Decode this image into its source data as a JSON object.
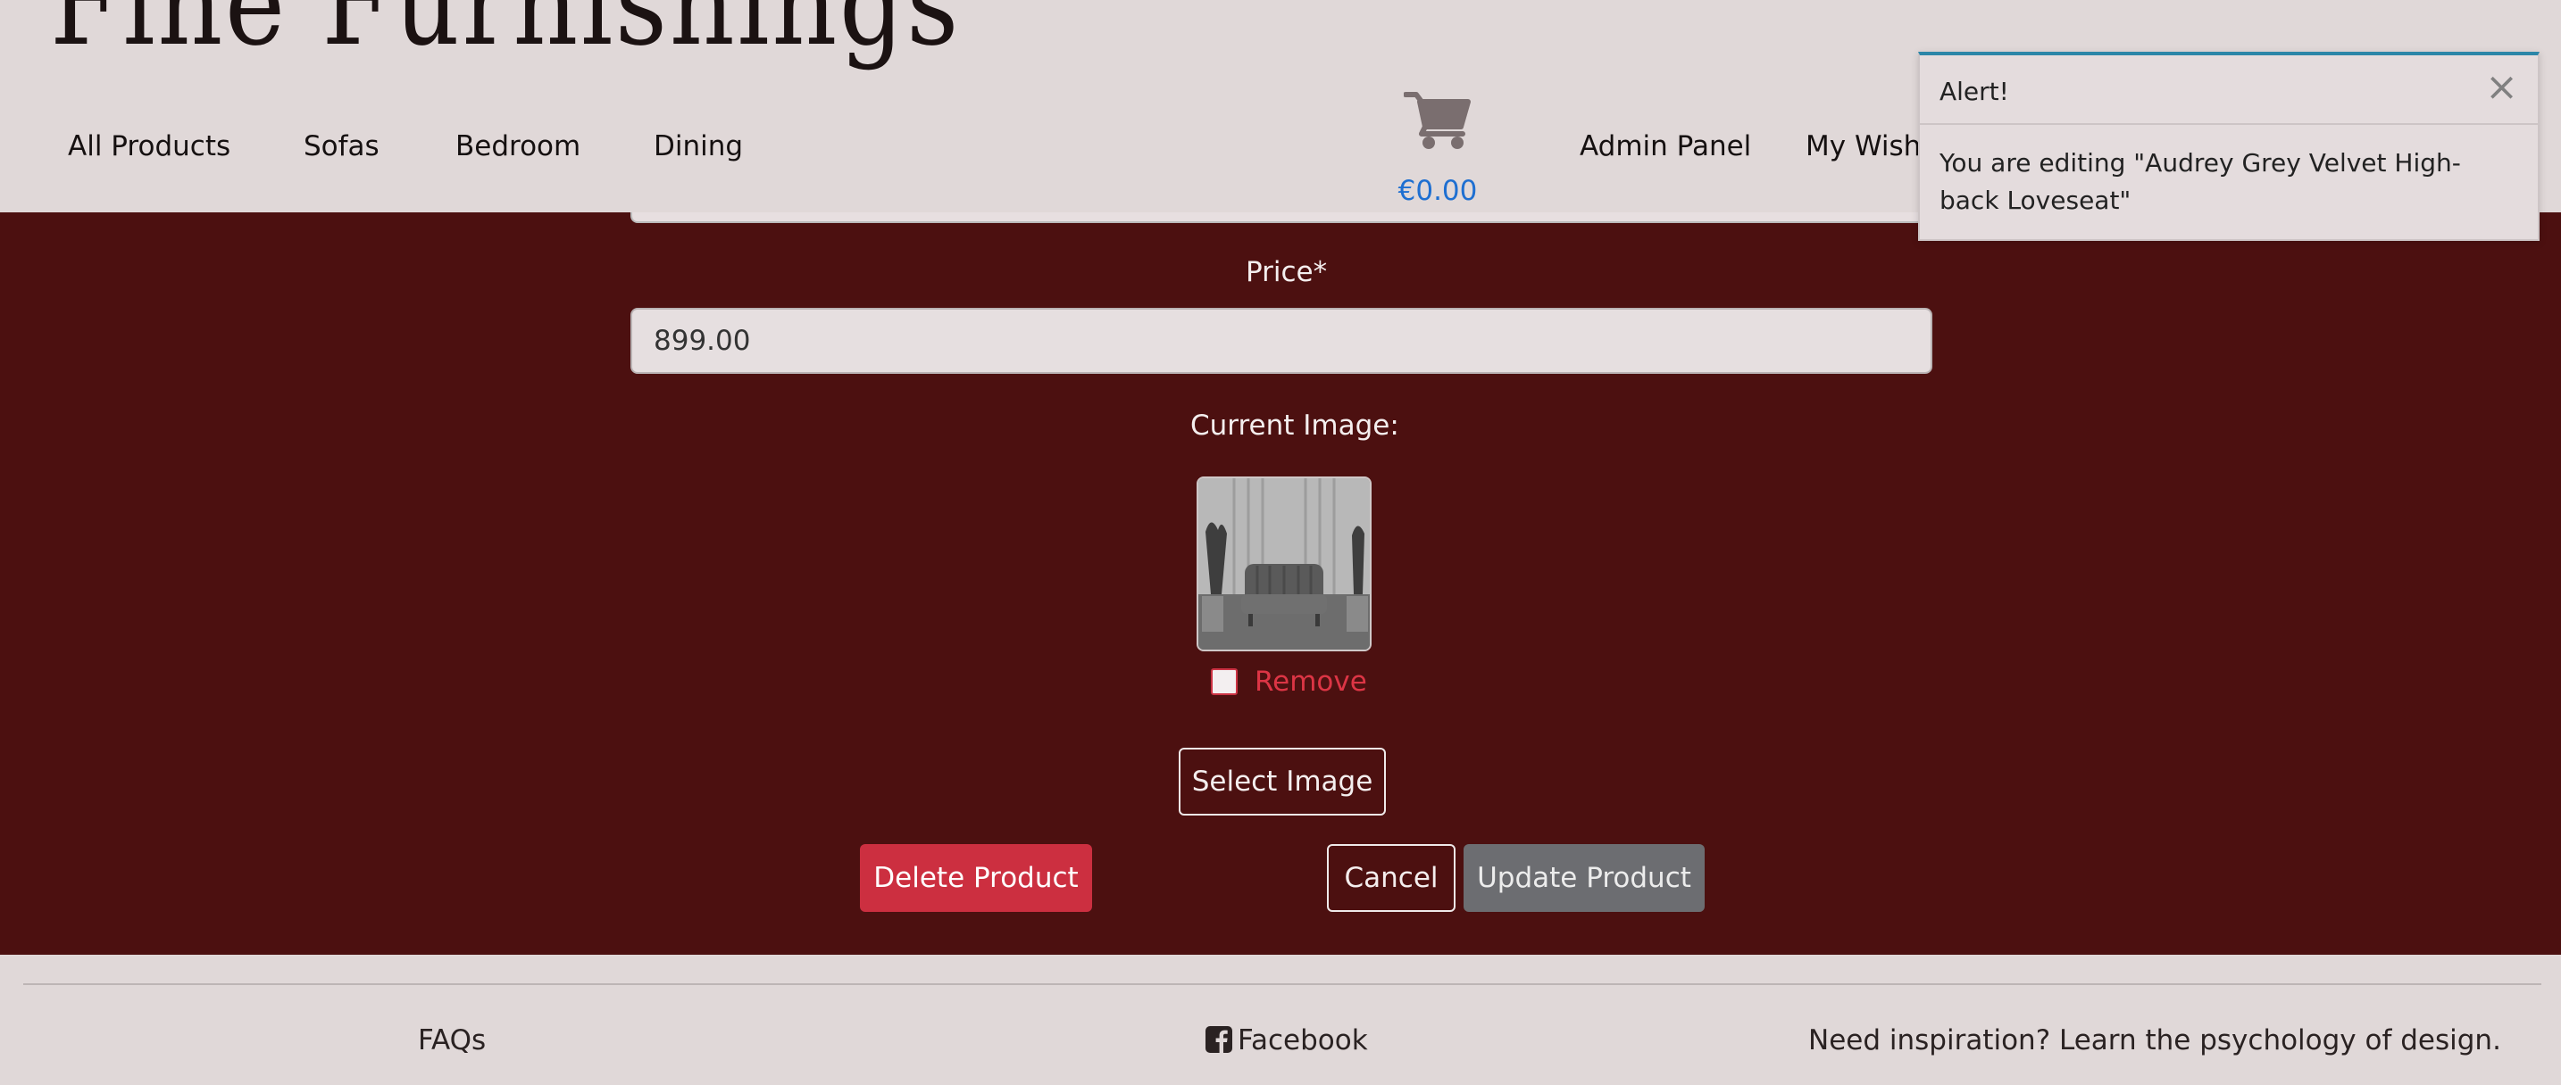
{
  "header": {
    "brand": "Fine Furnishings",
    "nav": [
      "All Products",
      "Sofas",
      "Bedroom",
      "Dining"
    ],
    "cart_total": "€0.00",
    "admin_link": "Admin Panel",
    "wishlist_link": "My Wishl"
  },
  "form": {
    "price_label": "Price*",
    "price_value": "899.00",
    "current_image_label": "Current Image:",
    "remove_label": "Remove",
    "remove_checked": false,
    "select_image_label": "Select Image",
    "delete_label": "Delete Product",
    "cancel_label": "Cancel",
    "update_label": "Update Product"
  },
  "footer": {
    "faqs": "FAQs",
    "facebook": "Facebook",
    "inspiration": "Need inspiration? Learn the psychology of design."
  },
  "alert": {
    "title": "Alert!",
    "close": "×",
    "message": "You are editing \"Audrey Grey Velvet High-back Loveseat\""
  },
  "colors": {
    "main_bg": "#4c1010",
    "header_bg": "#e0d8d8",
    "danger": "#cc2f40",
    "secondary": "#6c6d71",
    "cart_total": "#1e6fd1",
    "alert_accent": "#2b86a8"
  },
  "icons": {
    "cart": "shopping-cart-icon",
    "facebook": "facebook-square-icon",
    "close": "close-icon"
  }
}
